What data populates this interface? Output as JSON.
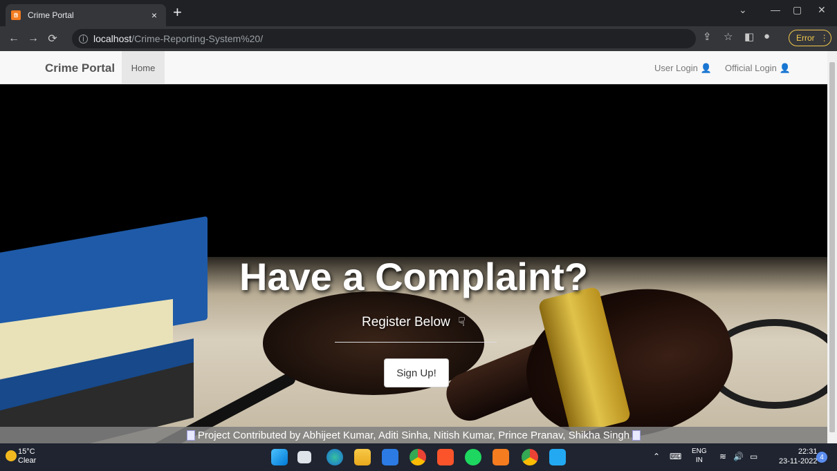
{
  "browser": {
    "tab_title": "Crime Portal",
    "tab_close": "×",
    "new_tab": "+",
    "url_host": "localhost",
    "url_path": "/Crime-Reporting-System%20/",
    "error_label": "Error",
    "win_minimize": "—",
    "win_restore": "▢",
    "win_close": "✕",
    "win_dropdown": "⌄"
  },
  "navbar": {
    "brand": "Crime Portal",
    "home": "Home",
    "user_login": "User Login",
    "official_login": "Official Login"
  },
  "hero": {
    "title": "Have a Complaint?",
    "subtitle": "Register Below",
    "signup_label": "Sign Up!"
  },
  "footer": {
    "text": "Project Contributed by Abhijeet Kumar, Aditi Sinha, Nitish Kumar, Prince Pranav, Shikha Singh"
  },
  "taskbar": {
    "temperature": "15°C",
    "weather": "Clear",
    "lang_top": "ENG",
    "lang_bottom": "IN",
    "time": "22:31",
    "date": "23-11-2022",
    "notifications": "4",
    "icons": [
      "windows-start",
      "task-view",
      "edge",
      "file-explorer",
      "mail",
      "chrome",
      "brave",
      "spotify",
      "xampp",
      "chrome-profile",
      "vscode"
    ]
  }
}
